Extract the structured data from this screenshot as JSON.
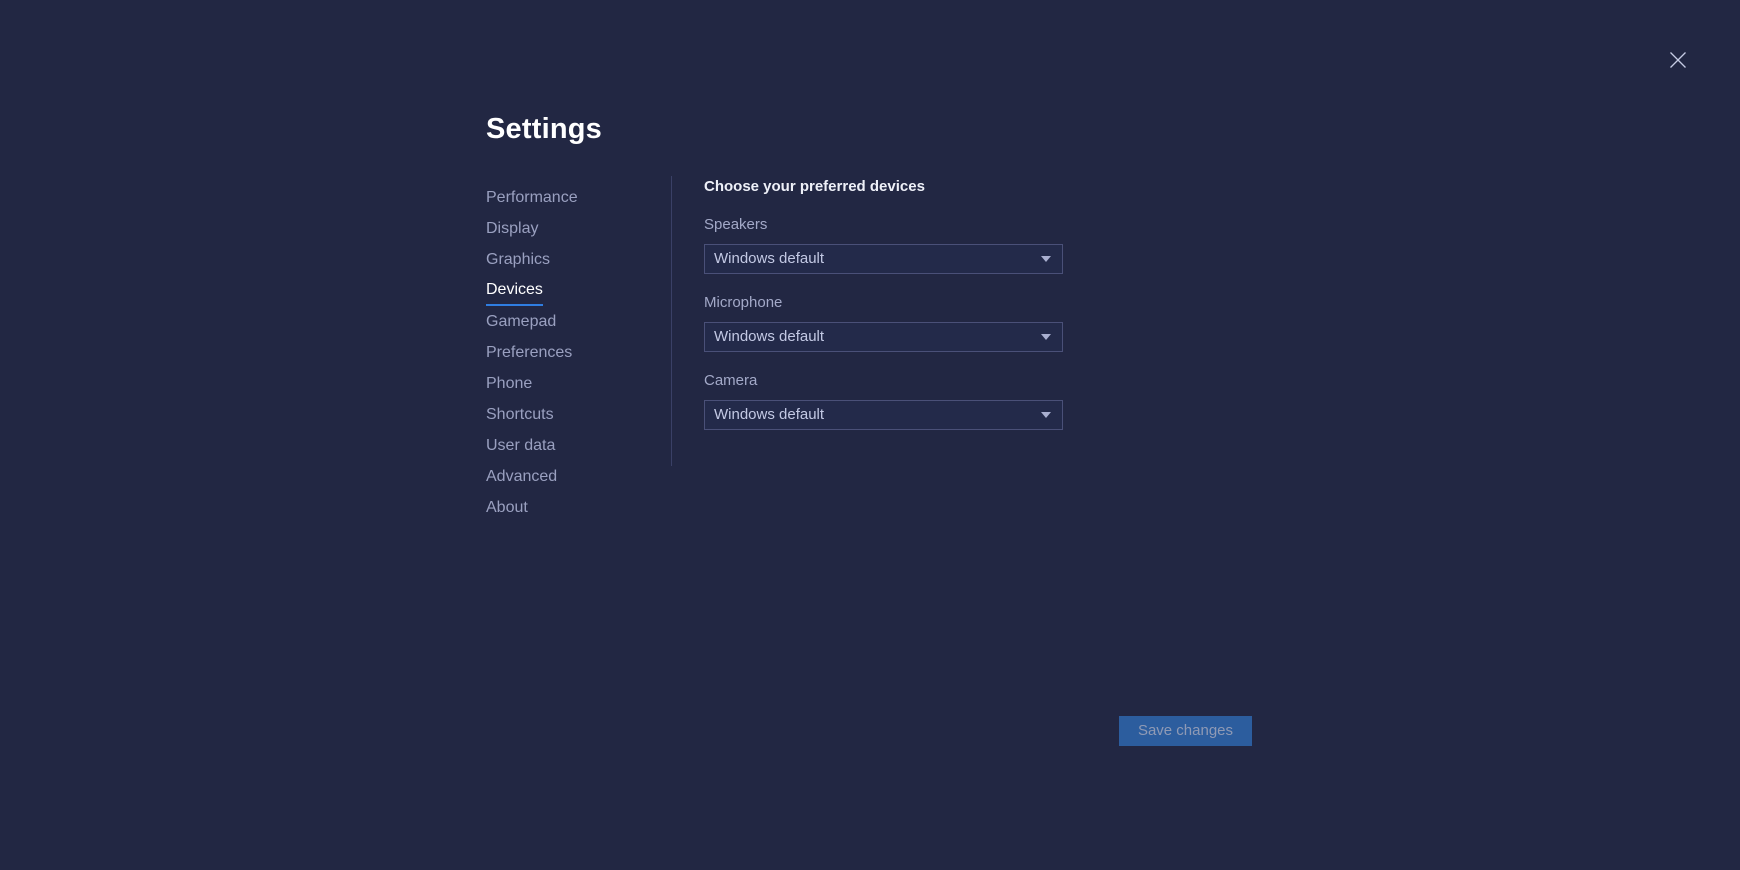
{
  "window": {
    "close_icon": "close-icon"
  },
  "header": {
    "title": "Settings"
  },
  "sidebar": {
    "items": [
      {
        "label": "Performance",
        "active": false
      },
      {
        "label": "Display",
        "active": false
      },
      {
        "label": "Graphics",
        "active": false
      },
      {
        "label": "Devices",
        "active": true
      },
      {
        "label": "Gamepad",
        "active": false
      },
      {
        "label": "Preferences",
        "active": false
      },
      {
        "label": "Phone",
        "active": false
      },
      {
        "label": "Shortcuts",
        "active": false
      },
      {
        "label": "User data",
        "active": false
      },
      {
        "label": "Advanced",
        "active": false
      },
      {
        "label": "About",
        "active": false
      }
    ]
  },
  "main": {
    "heading": "Choose your preferred devices",
    "fields": [
      {
        "label": "Speakers",
        "value": "Windows default",
        "caret_icon": "chevron-down-icon"
      },
      {
        "label": "Microphone",
        "value": "Windows default",
        "caret_icon": "chevron-down-icon"
      },
      {
        "label": "Camera",
        "value": "Windows default",
        "caret_icon": "chevron-down-icon"
      }
    ]
  },
  "footer": {
    "save_label": "Save changes"
  },
  "colors": {
    "background": "#222743",
    "accent": "#2f7de1",
    "button": "#2c5d9e",
    "divider": "#3a4066",
    "text_muted": "#9aa0c0",
    "text_primary": "#ffffff"
  }
}
